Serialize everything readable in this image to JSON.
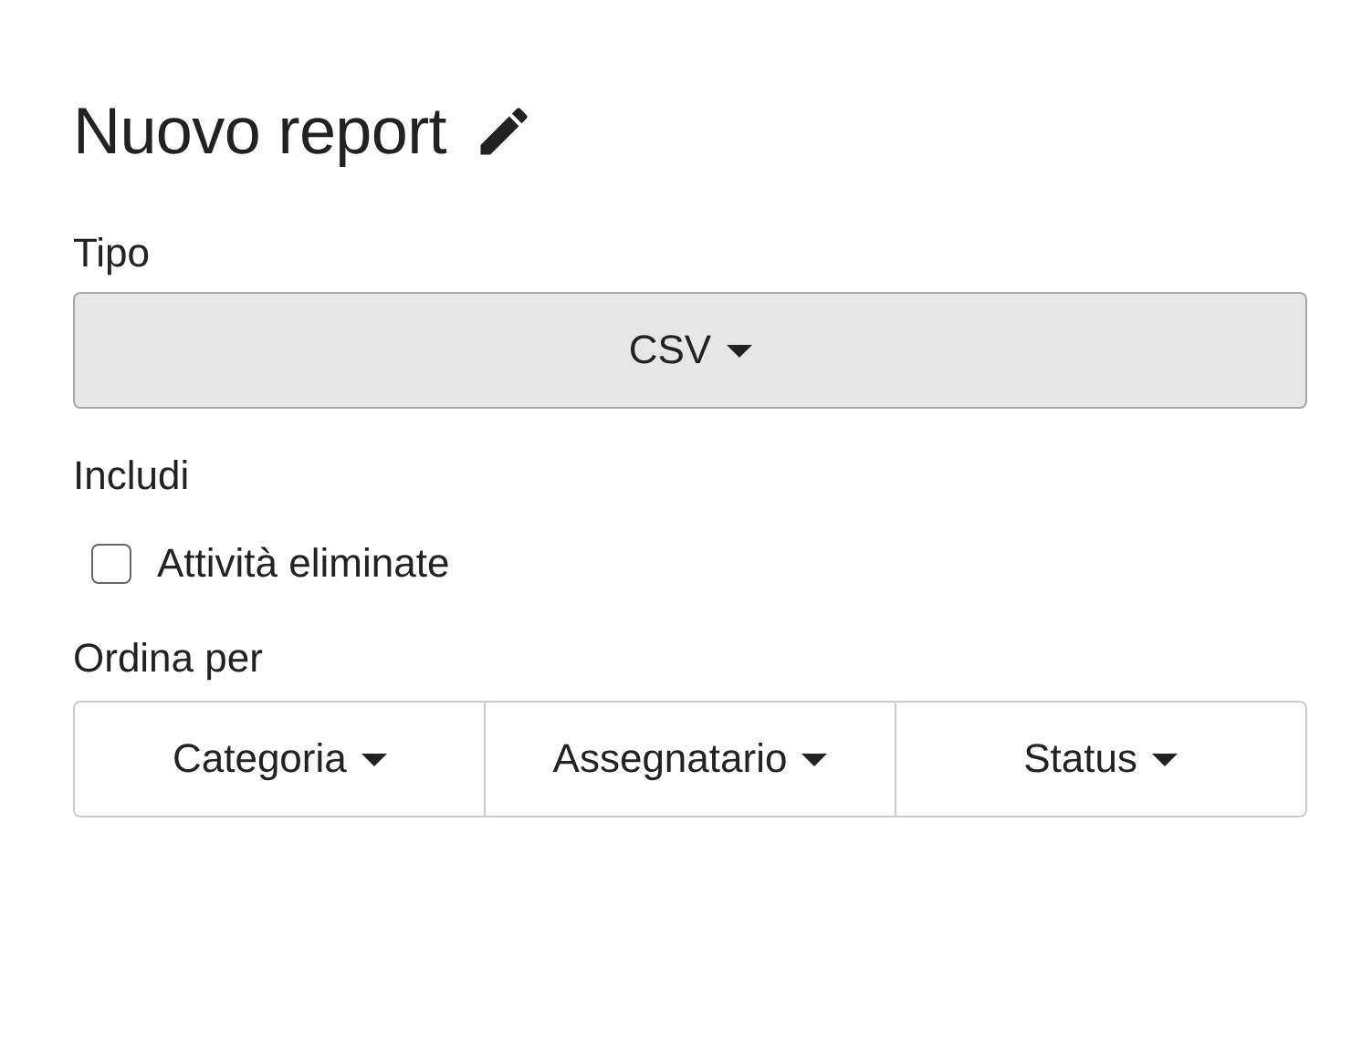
{
  "title": "Nuovo report",
  "type_field": {
    "label": "Tipo",
    "value": "CSV"
  },
  "include": {
    "label": "Includi",
    "options": [
      {
        "label": "Attività eliminate",
        "checked": false
      }
    ]
  },
  "sort": {
    "label": "Ordina per",
    "buttons": [
      {
        "label": "Categoria"
      },
      {
        "label": "Assegnatario"
      },
      {
        "label": "Status"
      }
    ]
  }
}
